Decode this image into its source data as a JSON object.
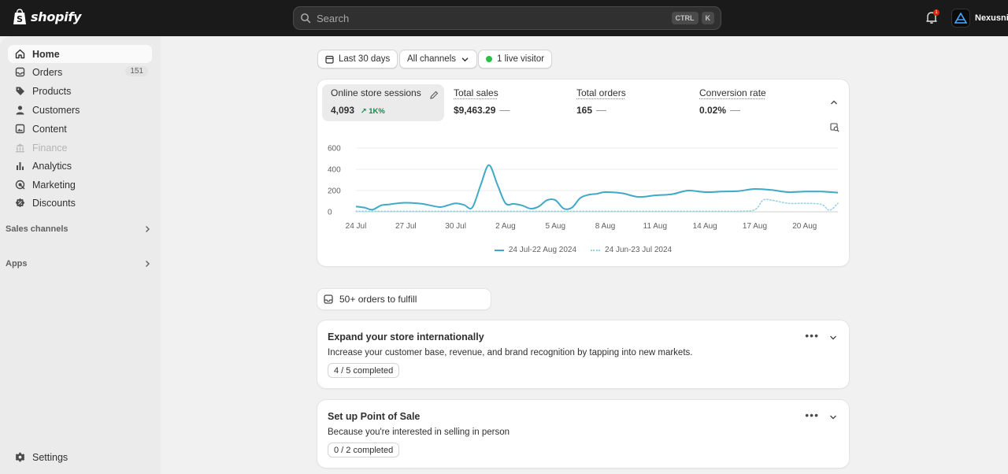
{
  "topbar": {
    "brand": "shopify",
    "search_placeholder": "Search",
    "shortcut_keys": [
      "CTRL",
      "K"
    ],
    "notification_count": "1",
    "store_name": "Nexusni"
  },
  "sidebar": {
    "items": [
      {
        "label": "Home",
        "icon": "home-icon",
        "active": true
      },
      {
        "label": "Orders",
        "icon": "inbox-icon",
        "count": "151"
      },
      {
        "label": "Products",
        "icon": "tag-icon"
      },
      {
        "label": "Customers",
        "icon": "person-icon"
      },
      {
        "label": "Content",
        "icon": "image-icon"
      },
      {
        "label": "Finance",
        "icon": "bank-icon",
        "disabled": true
      },
      {
        "label": "Analytics",
        "icon": "bar-chart-icon"
      },
      {
        "label": "Marketing",
        "icon": "target-icon"
      },
      {
        "label": "Discounts",
        "icon": "discount-icon"
      }
    ],
    "sections": [
      "Sales channels",
      "Apps"
    ],
    "settings_label": "Settings"
  },
  "filters": {
    "date_range": "Last 30 days",
    "channels": "All channels",
    "live_visitors": "1 live visitor"
  },
  "metrics": [
    {
      "label": "Online store sessions",
      "value": "4,093",
      "trend": "1K%"
    },
    {
      "label": "Total sales",
      "value": "$9,463.29",
      "trend": "—"
    },
    {
      "label": "Total orders",
      "value": "165",
      "trend": "—"
    },
    {
      "label": "Conversion rate",
      "value": "0.02%",
      "trend": "—"
    }
  ],
  "chart_data": {
    "type": "line",
    "title": "",
    "xlabel": "",
    "ylabel": "",
    "ylim": [
      0,
      600
    ],
    "yticks": [
      "600",
      "400",
      "200",
      "0"
    ],
    "xticks": [
      "24 Jul",
      "27 Jul",
      "30 Jul",
      "2 Aug",
      "5 Aug",
      "8 Aug",
      "11 Aug",
      "14 Aug",
      "17 Aug",
      "20 Aug"
    ],
    "grid": true,
    "legend_position": "bottom",
    "series": [
      {
        "name": "24 Jul-22 Aug 2024",
        "style": "solid",
        "color": "#3fa9c7",
        "x": [
          0,
          0.5,
          1,
          1.5,
          2,
          2.5,
          3,
          4,
          5,
          5.5,
          6,
          6.5,
          7,
          7.5,
          8,
          8.5,
          9,
          9.5,
          10,
          10.5,
          11,
          11.5,
          12,
          12.5,
          13,
          13.5,
          14,
          14.5,
          15,
          16,
          17,
          18,
          19,
          20,
          21,
          22,
          23,
          24,
          25,
          26,
          27,
          28,
          29
        ],
        "y": [
          50,
          40,
          20,
          60,
          70,
          80,
          85,
          75,
          45,
          60,
          80,
          65,
          40,
          250,
          440,
          260,
          80,
          75,
          60,
          30,
          50,
          110,
          110,
          30,
          40,
          130,
          160,
          170,
          185,
          175,
          140,
          155,
          165,
          200,
          185,
          190,
          195,
          215,
          205,
          185,
          190,
          190,
          180
        ]
      },
      {
        "name": "24 Jun-23 Jul 2024",
        "style": "dotted",
        "color": "#9bd2e2",
        "x": [
          0,
          1,
          2,
          3,
          4,
          5,
          6,
          7,
          8,
          9,
          10,
          11,
          12,
          13,
          14,
          15,
          16,
          17,
          18,
          19,
          20,
          21,
          22,
          23,
          24,
          24.5,
          25,
          26,
          27,
          28,
          28.5,
          29
        ],
        "y": [
          5,
          5,
          5,
          5,
          5,
          5,
          5,
          5,
          5,
          5,
          5,
          5,
          5,
          5,
          5,
          5,
          5,
          5,
          5,
          5,
          5,
          5,
          5,
          5,
          20,
          110,
          110,
          80,
          80,
          70,
          15,
          80
        ]
      }
    ]
  },
  "fulfill_label": "50+ orders to fulfill",
  "tasks": [
    {
      "title": "Expand your store internationally",
      "description": "Increase your customer base, revenue, and brand recognition by tapping into new markets.",
      "progress": "4 / 5 completed",
      "more": "•••"
    },
    {
      "title": "Set up Point of Sale",
      "description": "Because you're interested in selling in person",
      "progress": "0 / 2 completed",
      "more": "•••"
    }
  ]
}
